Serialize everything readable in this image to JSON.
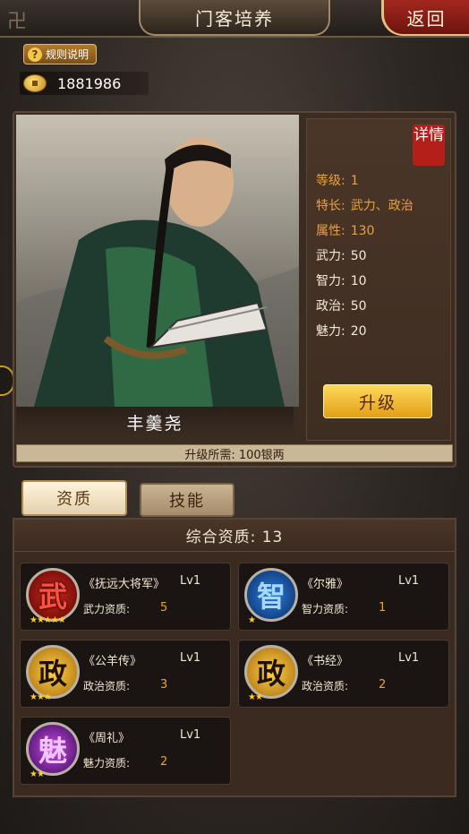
{
  "header": {
    "title": "门客培养",
    "back_label": "返回"
  },
  "rules_label": "规则说明",
  "money": "1881986",
  "hero": {
    "name": "丰羹尧",
    "detail_label": "详情",
    "stats": [
      {
        "key": "等级:",
        "value": "1"
      },
      {
        "key": "特长:",
        "value": "武力、政治"
      },
      {
        "key": "属性:",
        "value": "130"
      },
      {
        "key": "武力:",
        "value": "50"
      },
      {
        "key": "智力:",
        "value": "10"
      },
      {
        "key": "政治:",
        "value": "50"
      },
      {
        "key": "魅力:",
        "value": "20"
      }
    ],
    "upgrade_label": "升级",
    "cost_text": "升级所需: 100银两"
  },
  "tabs": {
    "aptitude": "资质",
    "skill": "技能"
  },
  "talent": {
    "summary": "综合资质: 13",
    "cards": [
      {
        "glyph": "武",
        "book": "《抚远大将军》",
        "level": "Lv1",
        "attr": "武力资质:",
        "value": "5",
        "stars": "★★★★★",
        "color": "#d2261d"
      },
      {
        "glyph": "智",
        "book": "《尔雅》",
        "level": "Lv1",
        "attr": "智力资质:",
        "value": "1",
        "stars": "★",
        "color": "#2a7ee0"
      },
      {
        "glyph": "政",
        "book": "《公羊传》",
        "level": "Lv1",
        "attr": "政治资质:",
        "value": "3",
        "stars": "★★★",
        "color": "#ffd24a"
      },
      {
        "glyph": "政",
        "book": "《书经》",
        "level": "Lv1",
        "attr": "政治资质:",
        "value": "2",
        "stars": "★★",
        "color": "#ffd24a"
      },
      {
        "glyph": "魅",
        "book": "《周礼》",
        "level": "Lv1",
        "attr": "魅力资质:",
        "value": "2",
        "stars": "★★",
        "color": "#c34ae8"
      }
    ]
  }
}
